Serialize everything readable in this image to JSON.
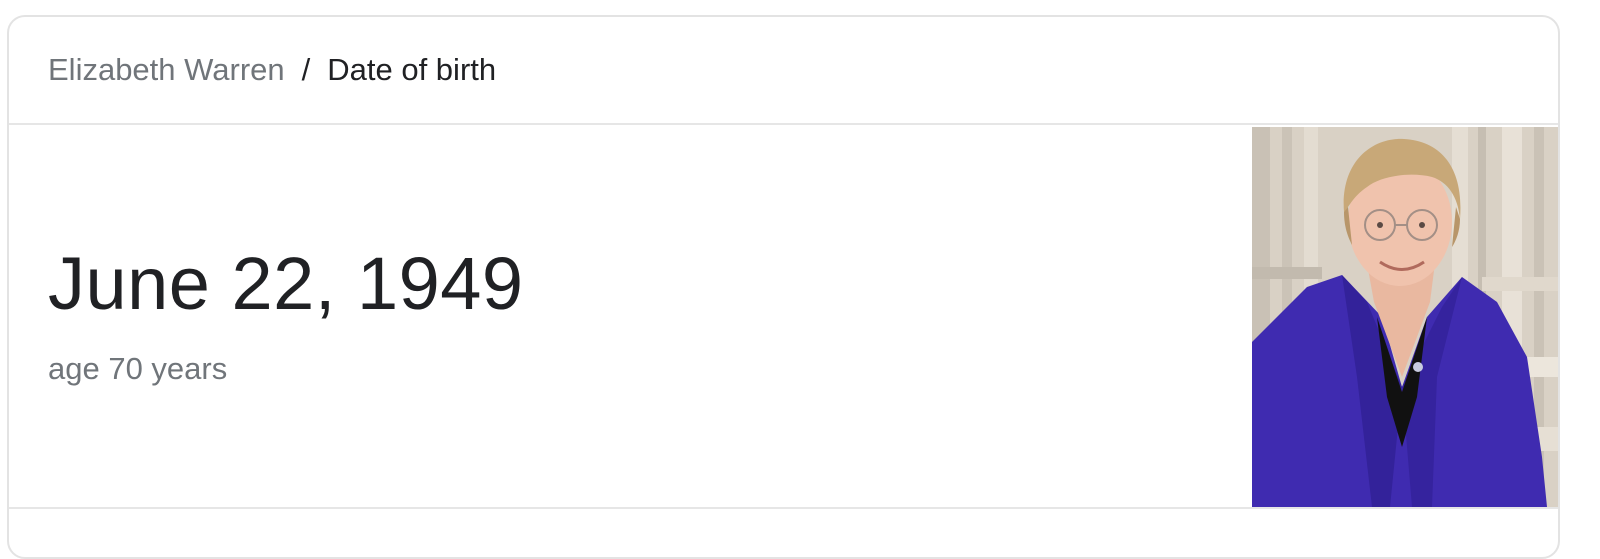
{
  "breadcrumb": {
    "parent": "Elizabeth Warren",
    "separator": "/",
    "current": "Date of birth"
  },
  "answer": {
    "value": "June 22, 1949",
    "subtext": "age 70 years"
  },
  "photo": {
    "subject": "portrait of Elizabeth Warren",
    "jacket_color": "#3f2bb0",
    "hair_color": "#c8a878",
    "background_color": "#d8d0c4"
  },
  "colors": {
    "primary_text": "#202124",
    "secondary_text": "#70757a",
    "border": "#e3e3e3"
  }
}
